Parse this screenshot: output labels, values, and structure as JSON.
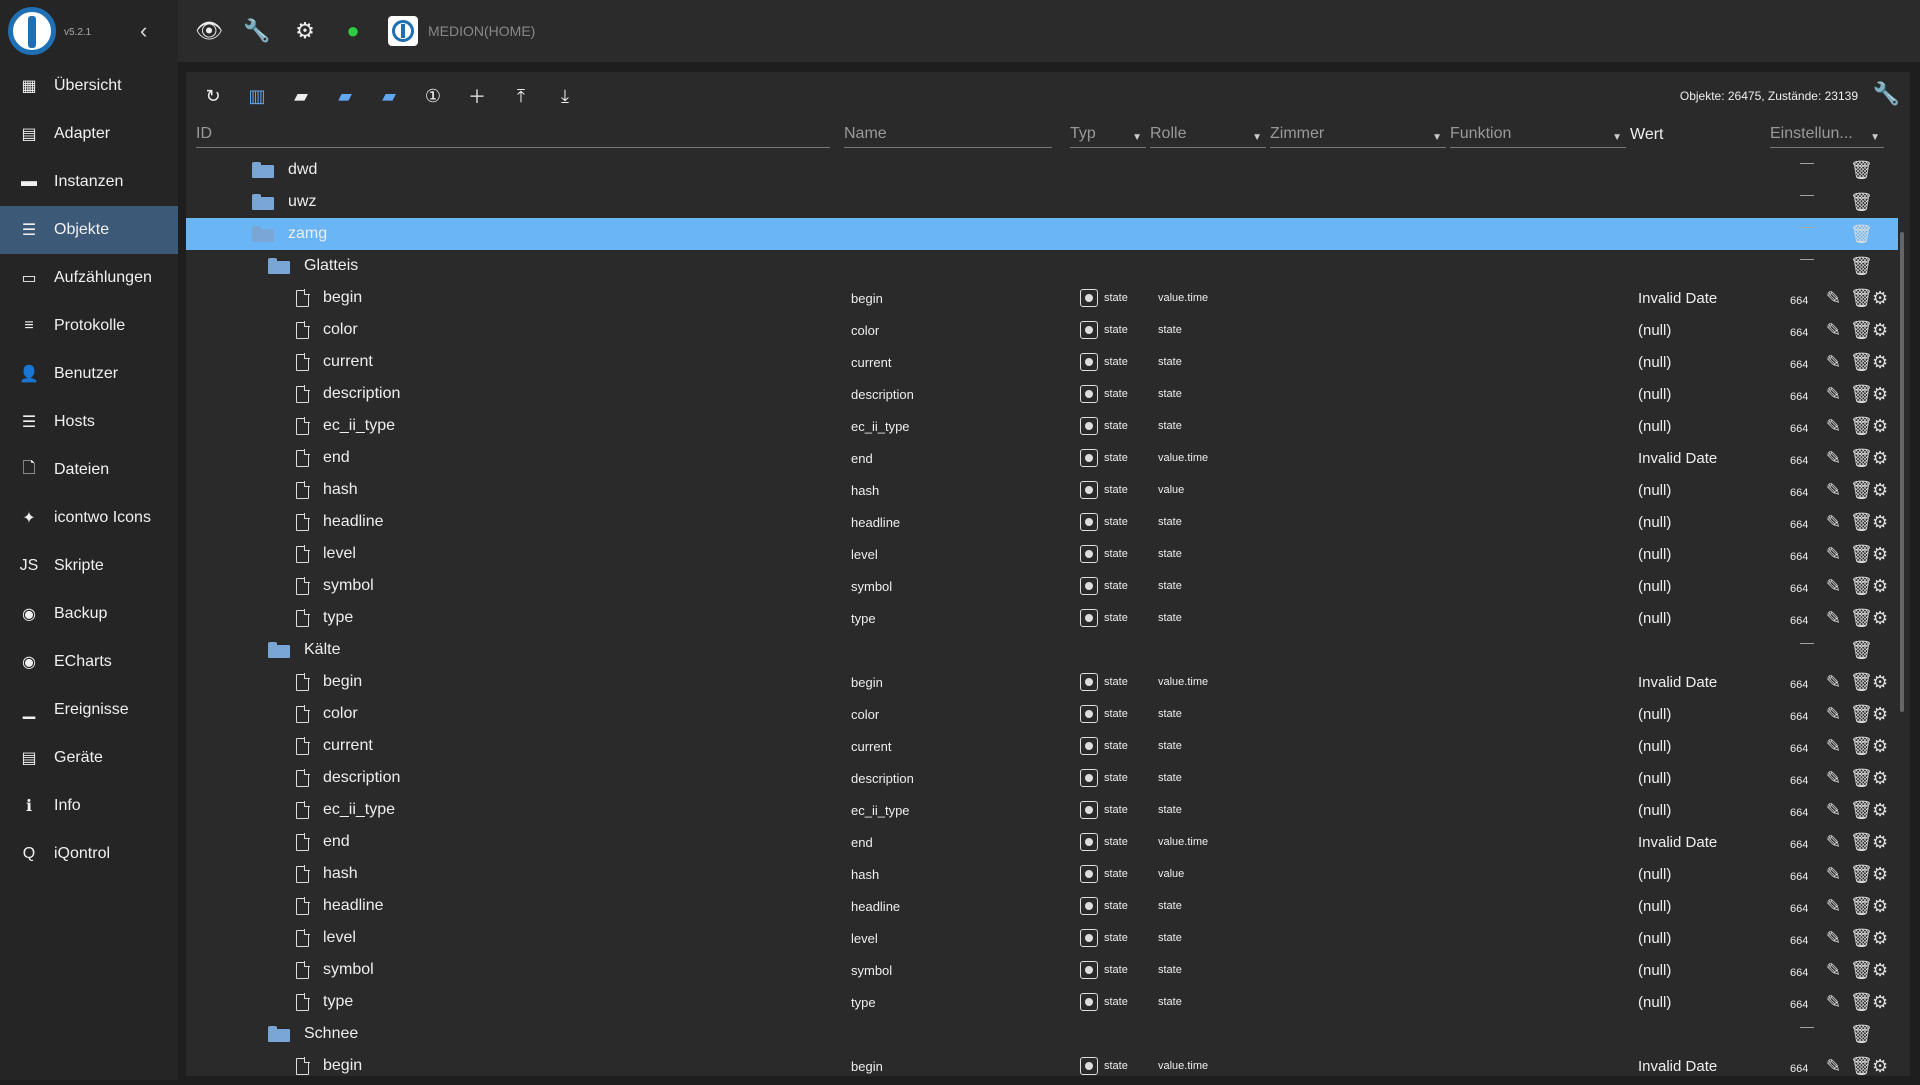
{
  "app": {
    "version": "v5.2.1",
    "host": "MEDION(HOME)"
  },
  "sidebar": {
    "items": [
      {
        "label": "Übersicht",
        "icon": "grid-icon",
        "glyph": "▦"
      },
      {
        "label": "Adapter",
        "icon": "store-icon",
        "glyph": "▤"
      },
      {
        "label": "Instanzen",
        "icon": "instances-icon",
        "glyph": "▬"
      },
      {
        "label": "Objekte",
        "icon": "list-icon",
        "glyph": "☰",
        "active": true
      },
      {
        "label": "Aufzählungen",
        "icon": "enum-icon",
        "glyph": "▭"
      },
      {
        "label": "Protokolle",
        "icon": "log-icon",
        "glyph": "≡"
      },
      {
        "label": "Benutzer",
        "icon": "user-icon",
        "glyph": "👤"
      },
      {
        "label": "Hosts",
        "icon": "hosts-icon",
        "glyph": "☰"
      },
      {
        "label": "Dateien",
        "icon": "files-icon",
        "glyph": "🗋"
      },
      {
        "label": "icontwo Icons",
        "icon": "icontwo-icon",
        "glyph": "✦"
      },
      {
        "label": "Skripte",
        "icon": "scripts-icon",
        "glyph": "JS"
      },
      {
        "label": "Backup",
        "icon": "backup-icon",
        "glyph": "◉"
      },
      {
        "label": "ECharts",
        "icon": "echarts-icon",
        "glyph": "◉"
      },
      {
        "label": "Ereignisse",
        "icon": "events-icon",
        "glyph": "▁"
      },
      {
        "label": "Geräte",
        "icon": "devices-icon",
        "glyph": "▤"
      },
      {
        "label": "Info",
        "icon": "info-icon",
        "glyph": "ℹ"
      },
      {
        "label": "iQontrol",
        "icon": "iqontrol-icon",
        "glyph": "Q"
      }
    ]
  },
  "toolbar": {
    "counts": "Objekte: 26475, Zustände: 23139"
  },
  "header": {
    "id": "ID",
    "name": "Name",
    "typ": "Typ",
    "rolle": "Rolle",
    "zimmer": "Zimmer",
    "funktion": "Funktion",
    "wert": "Wert",
    "settings": "Einstellun..."
  },
  "rows": [
    {
      "kind": "folder",
      "indent": 0,
      "id": "dwd"
    },
    {
      "kind": "folder",
      "indent": 0,
      "id": "uwz"
    },
    {
      "kind": "folder",
      "indent": 0,
      "id": "zamg",
      "selected": true
    },
    {
      "kind": "folder",
      "indent": 1,
      "id": "Glatteis"
    },
    {
      "kind": "state",
      "indent": 2,
      "id": "begin",
      "name": "begin",
      "typ": "state",
      "rolle": "value.time",
      "wert": "Invalid Date",
      "acl": "664"
    },
    {
      "kind": "state",
      "indent": 2,
      "id": "color",
      "name": "color",
      "typ": "state",
      "rolle": "state",
      "wert": "(null)",
      "acl": "664"
    },
    {
      "kind": "state",
      "indent": 2,
      "id": "current",
      "name": "current",
      "typ": "state",
      "rolle": "state",
      "wert": "(null)",
      "acl": "664"
    },
    {
      "kind": "state",
      "indent": 2,
      "id": "description",
      "name": "description",
      "typ": "state",
      "rolle": "state",
      "wert": "(null)",
      "acl": "664"
    },
    {
      "kind": "state",
      "indent": 2,
      "id": "ec_ii_type",
      "name": "ec_ii_type",
      "typ": "state",
      "rolle": "state",
      "wert": "(null)",
      "acl": "664"
    },
    {
      "kind": "state",
      "indent": 2,
      "id": "end",
      "name": "end",
      "typ": "state",
      "rolle": "value.time",
      "wert": "Invalid Date",
      "acl": "664"
    },
    {
      "kind": "state",
      "indent": 2,
      "id": "hash",
      "name": "hash",
      "typ": "state",
      "rolle": "value",
      "wert": "(null)",
      "acl": "664"
    },
    {
      "kind": "state",
      "indent": 2,
      "id": "headline",
      "name": "headline",
      "typ": "state",
      "rolle": "state",
      "wert": "(null)",
      "acl": "664"
    },
    {
      "kind": "state",
      "indent": 2,
      "id": "level",
      "name": "level",
      "typ": "state",
      "rolle": "state",
      "wert": "(null)",
      "acl": "664"
    },
    {
      "kind": "state",
      "indent": 2,
      "id": "symbol",
      "name": "symbol",
      "typ": "state",
      "rolle": "state",
      "wert": "(null)",
      "acl": "664"
    },
    {
      "kind": "state",
      "indent": 2,
      "id": "type",
      "name": "type",
      "typ": "state",
      "rolle": "state",
      "wert": "(null)",
      "acl": "664"
    },
    {
      "kind": "folder",
      "indent": 1,
      "id": "Kälte"
    },
    {
      "kind": "state",
      "indent": 2,
      "id": "begin",
      "name": "begin",
      "typ": "state",
      "rolle": "value.time",
      "wert": "Invalid Date",
      "acl": "664"
    },
    {
      "kind": "state",
      "indent": 2,
      "id": "color",
      "name": "color",
      "typ": "state",
      "rolle": "state",
      "wert": "(null)",
      "acl": "664"
    },
    {
      "kind": "state",
      "indent": 2,
      "id": "current",
      "name": "current",
      "typ": "state",
      "rolle": "state",
      "wert": "(null)",
      "acl": "664"
    },
    {
      "kind": "state",
      "indent": 2,
      "id": "description",
      "name": "description",
      "typ": "state",
      "rolle": "state",
      "wert": "(null)",
      "acl": "664"
    },
    {
      "kind": "state",
      "indent": 2,
      "id": "ec_ii_type",
      "name": "ec_ii_type",
      "typ": "state",
      "rolle": "state",
      "wert": "(null)",
      "acl": "664"
    },
    {
      "kind": "state",
      "indent": 2,
      "id": "end",
      "name": "end",
      "typ": "state",
      "rolle": "value.time",
      "wert": "Invalid Date",
      "acl": "664"
    },
    {
      "kind": "state",
      "indent": 2,
      "id": "hash",
      "name": "hash",
      "typ": "state",
      "rolle": "value",
      "wert": "(null)",
      "acl": "664"
    },
    {
      "kind": "state",
      "indent": 2,
      "id": "headline",
      "name": "headline",
      "typ": "state",
      "rolle": "state",
      "wert": "(null)",
      "acl": "664"
    },
    {
      "kind": "state",
      "indent": 2,
      "id": "level",
      "name": "level",
      "typ": "state",
      "rolle": "state",
      "wert": "(null)",
      "acl": "664"
    },
    {
      "kind": "state",
      "indent": 2,
      "id": "symbol",
      "name": "symbol",
      "typ": "state",
      "rolle": "state",
      "wert": "(null)",
      "acl": "664"
    },
    {
      "kind": "state",
      "indent": 2,
      "id": "type",
      "name": "type",
      "typ": "state",
      "rolle": "state",
      "wert": "(null)",
      "acl": "664"
    },
    {
      "kind": "folder",
      "indent": 1,
      "id": "Schnee"
    },
    {
      "kind": "state",
      "indent": 2,
      "id": "begin",
      "name": "begin",
      "typ": "state",
      "rolle": "value.time",
      "wert": "Invalid Date",
      "acl": "664"
    }
  ]
}
